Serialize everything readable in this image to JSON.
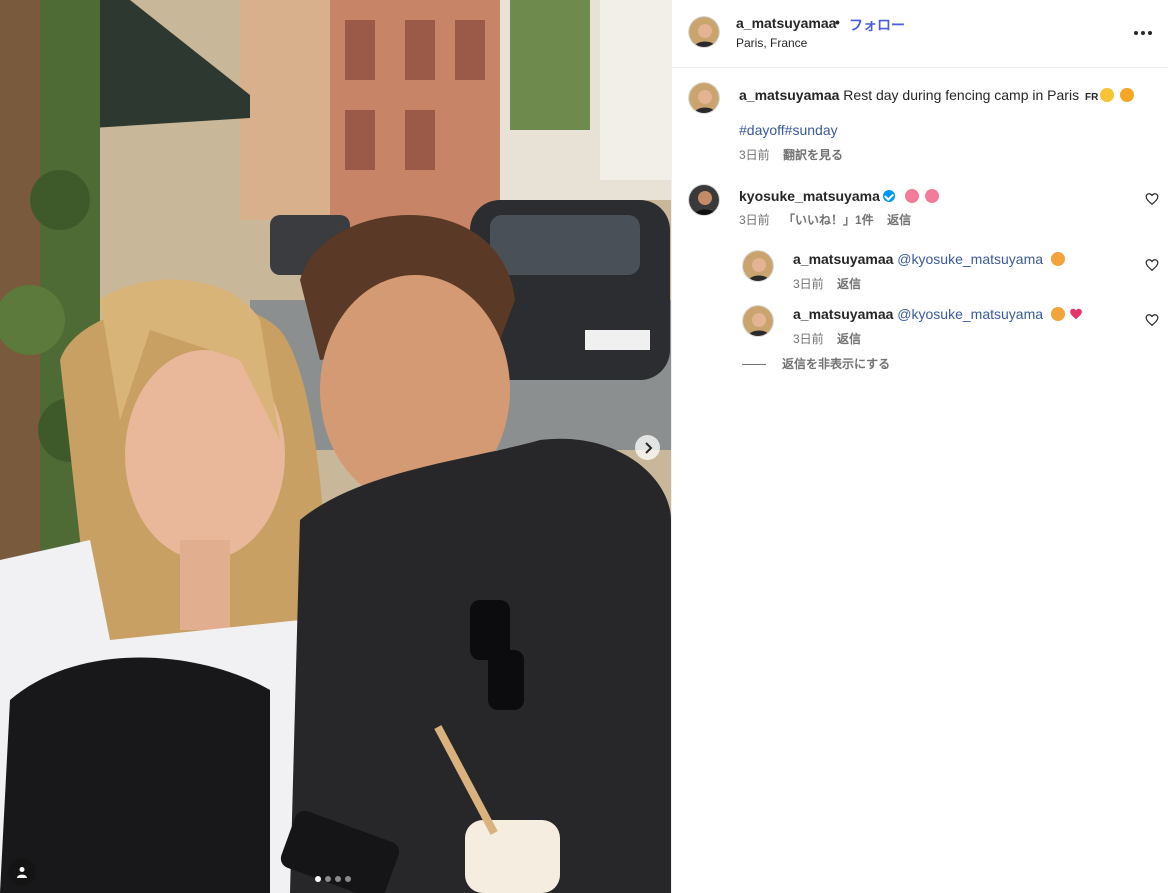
{
  "media": {
    "next_icon": "chevron-right-icon",
    "tag_icon": "user-tag-icon",
    "carousel_total": 4,
    "carousel_active": 1
  },
  "post_header": {
    "username": "a_matsuyamaa",
    "separator": "•",
    "follow_label": "フォロー",
    "location": "Paris, France",
    "more_icon": "more-options-icon"
  },
  "caption": {
    "username": "a_matsuyamaa",
    "text": "Rest day during fencing camp in Paris",
    "flag_text": "FR",
    "hashtags": [
      "#dayoff",
      "#sunday"
    ],
    "time": "3日前",
    "translate_label": "翻訳を見る"
  },
  "comments": [
    {
      "username": "kyosuke_matsuyama",
      "verified": true,
      "time": "3日前",
      "likes_label": "「いいね！」1件",
      "reply_label": "返信",
      "replies": [
        {
          "username": "a_matsuyamaa",
          "mention": "@kyosuke_matsuyama",
          "time": "3日前",
          "reply_label": "返信"
        },
        {
          "username": "a_matsuyamaa",
          "mention": "@kyosuke_matsuyama",
          "time": "3日前",
          "reply_label": "返信"
        }
      ],
      "hide_replies_label": "返信を非表示にする"
    }
  ],
  "colors": {
    "link_blue": "#4a5de0",
    "hashtag_blue": "#3b5a9a",
    "verified_blue": "#0095f6",
    "muted": "#737373",
    "heart_pink": "#e8336b"
  }
}
